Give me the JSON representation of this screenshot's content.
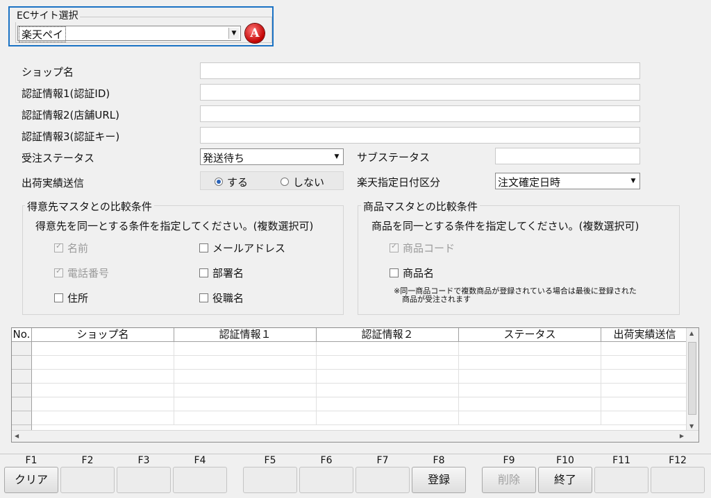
{
  "ec_site": {
    "group_label": "ECサイト選択",
    "selected": "楽天ペイ",
    "help_icon_letter": "A"
  },
  "form": {
    "shop_name_label": "ショップ名",
    "auth1_label": "認証情報1(認証ID)",
    "auth2_label": "認証情報2(店舗URL)",
    "auth3_label": "認証情報3(認証キー)",
    "order_status_label": "受注ステータス",
    "order_status_value": "発送待ち",
    "sub_status_label": "サブステータス",
    "shipment_send_label": "出荷実績送信",
    "radio_yes": "する",
    "radio_no": "しない",
    "rakuten_date_label": "楽天指定日付区分",
    "rakuten_date_value": "注文確定日時"
  },
  "customer_group": {
    "title": "得意先マスタとの比較条件",
    "instruction": "得意先を同一とする条件を指定してください。(複数選択可)",
    "options": {
      "name": "名前",
      "email": "メールアドレス",
      "phone": "電話番号",
      "dept": "部署名",
      "address": "住所",
      "position": "役職名"
    }
  },
  "product_group": {
    "title": "商品マスタとの比較条件",
    "instruction": "商品を同一とする条件を指定してください。(複数選択可)",
    "options": {
      "code": "商品コード",
      "name": "商品名"
    },
    "note_line1": "※同一商品コードで複数商品が登録されている場合は最後に登録された",
    "note_line2": "商品が受注されます"
  },
  "table": {
    "columns": [
      "No.",
      "ショップ名",
      "認証情報１",
      "認証情報２",
      "ステータス",
      "出荷実績送信"
    ]
  },
  "function_keys": [
    {
      "key": "F1",
      "label": "クリア"
    },
    {
      "key": "F2",
      "label": ""
    },
    {
      "key": "F3",
      "label": ""
    },
    {
      "key": "F4",
      "label": ""
    },
    {
      "key": "F5",
      "label": ""
    },
    {
      "key": "F6",
      "label": ""
    },
    {
      "key": "F7",
      "label": ""
    },
    {
      "key": "F8",
      "label": "登録"
    },
    {
      "key": "F9",
      "label": "削除"
    },
    {
      "key": "F10",
      "label": "終了"
    },
    {
      "key": "F11",
      "label": ""
    },
    {
      "key": "F12",
      "label": ""
    }
  ]
}
